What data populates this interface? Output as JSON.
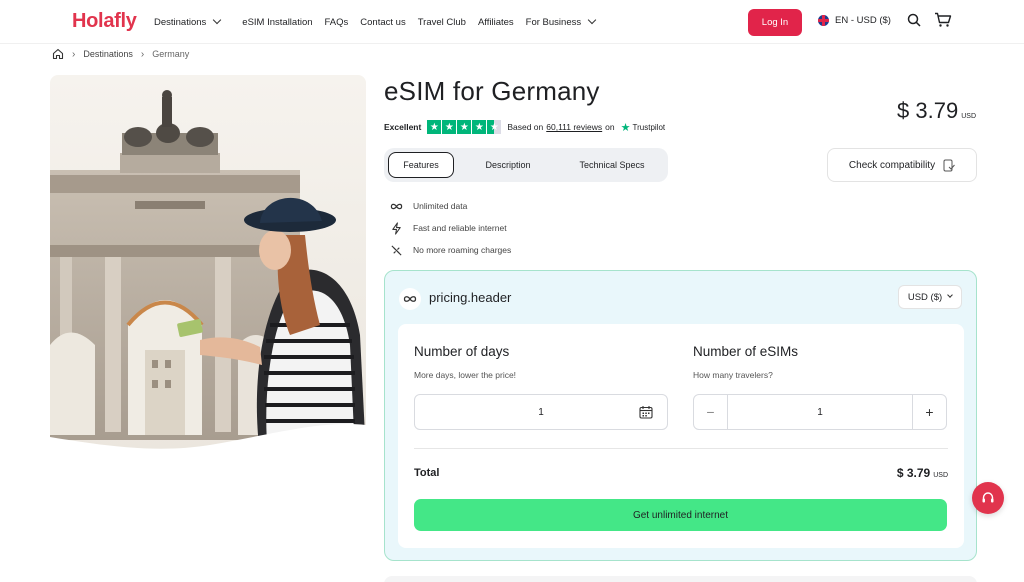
{
  "brand": {
    "logo": "Holafly",
    "accent": "#e1344d",
    "cta_color": "#44e787"
  },
  "nav": {
    "links": [
      {
        "label": "Destinations",
        "dropdown": true
      },
      {
        "label": "eSIM Installation",
        "dropdown": false
      },
      {
        "label": "FAQs",
        "dropdown": false
      },
      {
        "label": "Contact us",
        "dropdown": false
      },
      {
        "label": "Travel Club",
        "dropdown": false
      },
      {
        "label": "Affiliates",
        "dropdown": false
      },
      {
        "label": "For Business",
        "dropdown": true
      }
    ],
    "login_label": "Log In",
    "language": "EN - USD ($)"
  },
  "breadcrumb": {
    "items": [
      "Destinations",
      "Germany"
    ]
  },
  "product": {
    "title": "eSIM for Germany",
    "price": "$ 3.79",
    "price_currency": "USD",
    "rating": {
      "label": "Excellent",
      "stars": 4.5,
      "based_prefix": "Based on",
      "reviews": "60,111 reviews",
      "on": "on",
      "provider": "Trustpilot"
    },
    "tabs": [
      "Features",
      "Description",
      "Technical Specs"
    ],
    "active_tab": "Features",
    "check_label": "Check compatibility",
    "features": [
      {
        "icon": "infinity-icon",
        "label": "Unlimited data"
      },
      {
        "icon": "lightning-icon",
        "label": "Fast and reliable internet"
      },
      {
        "icon": "no-roaming-icon",
        "label": "No more roaming charges"
      }
    ]
  },
  "pricing": {
    "header": "pricing.header",
    "currency_select": "USD ($)",
    "days": {
      "title": "Number of days",
      "subtitle": "More days, lower the price!",
      "value": "1"
    },
    "esims": {
      "title": "Number of eSIMs",
      "subtitle": "How many travelers?",
      "value": "1",
      "minus": "−",
      "plus": "+"
    },
    "total_label": "Total",
    "total_amount": "$ 3.79",
    "total_currency": "USD",
    "cta_label": "Get unlimited internet"
  }
}
